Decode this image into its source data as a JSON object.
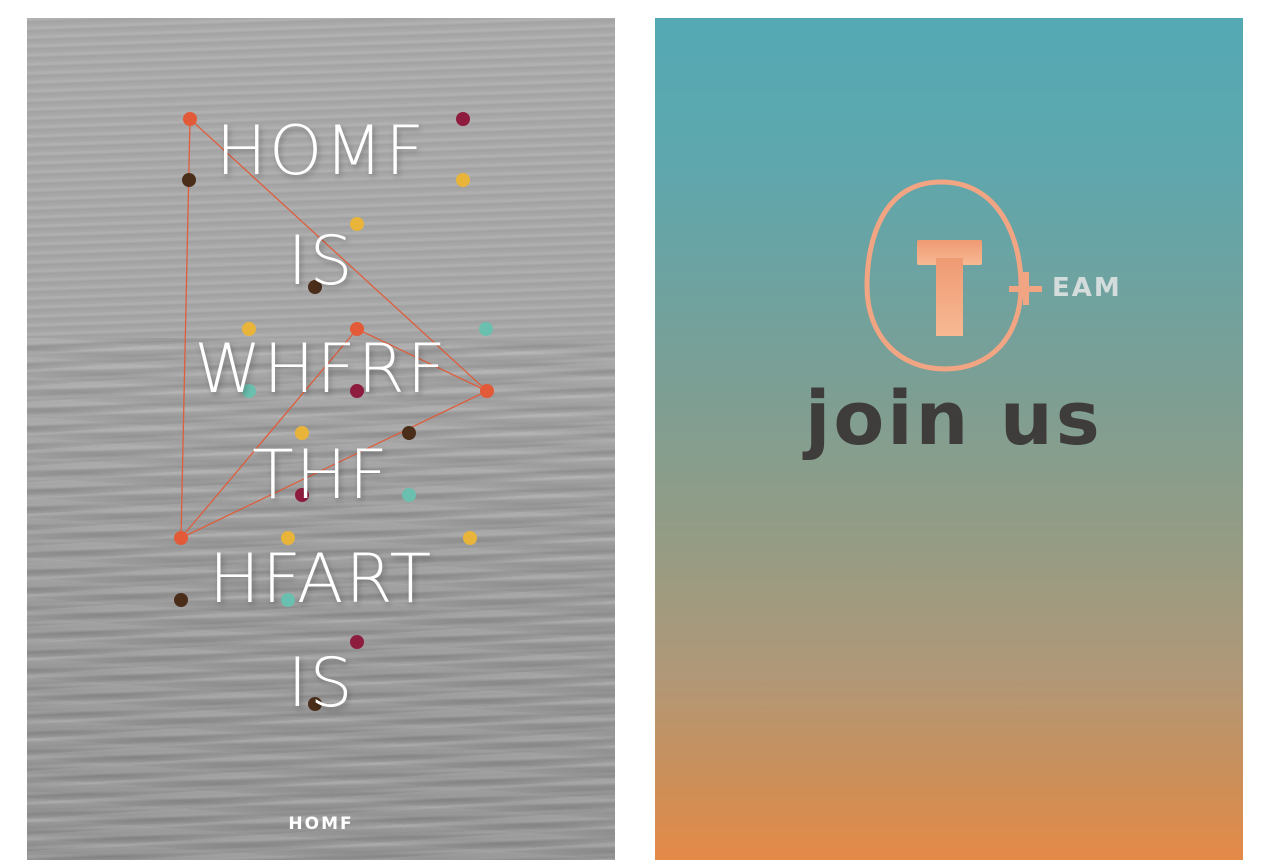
{
  "poster_left": {
    "title_lines": [
      "HOMF",
      "IS",
      "WHFRF",
      "THF",
      "HFART",
      "IS"
    ],
    "brand": "HOMF",
    "dot_colors": [
      "#e25a37",
      "#8e1c3f",
      "#4a2e1a",
      "#e8b43a",
      "#6bbfae"
    ],
    "line_color": "#e25a37"
  },
  "poster_right": {
    "logo_letter": "T",
    "logo_suffix": "EAM",
    "headline": "join us",
    "accent_color": "#f2a583",
    "text_color": "#3f3c3c"
  }
}
